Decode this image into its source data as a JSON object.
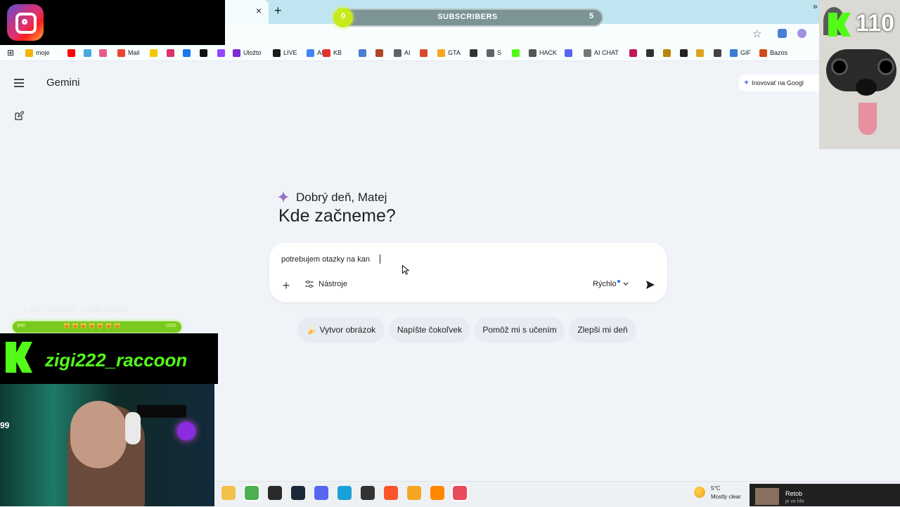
{
  "browser": {
    "new_tab_symbol": "+",
    "close_symbol": "×",
    "bookmarks": [
      {
        "label": "moje",
        "color": "#f4b400"
      },
      {
        "label": "",
        "color": "#ff0000"
      },
      {
        "label": "",
        "color": "#4aa8e0"
      },
      {
        "label": "",
        "color": "#e85a8a"
      },
      {
        "label": "Mail",
        "color": "#ea4335"
      },
      {
        "label": "",
        "color": "#f6c700"
      },
      {
        "label": "",
        "color": "#e1306c"
      },
      {
        "label": "",
        "color": "#1877f2"
      },
      {
        "label": "",
        "color": "#111111"
      },
      {
        "label": "",
        "color": "#9146ff"
      },
      {
        "label": "Uložto",
        "color": "#7a2bd3"
      },
      {
        "label": "LIVE",
        "color": "#1a1a1a"
      },
      {
        "label": "AI",
        "color": "#4285f4"
      },
      {
        "label": "KB",
        "color": "#e6322c"
      },
      {
        "label": "",
        "color": "#4a7fd6"
      },
      {
        "label": "",
        "color": "#b0442a"
      },
      {
        "label": "AI",
        "color": "#5f6368"
      },
      {
        "label": "",
        "color": "#d94a2a"
      },
      {
        "label": "GTA",
        "color": "#f5a623"
      },
      {
        "label": "",
        "color": "#333333"
      },
      {
        "label": "S",
        "color": "#5f6368"
      },
      {
        "label": "",
        "color": "#53fc18"
      },
      {
        "label": "HACK",
        "color": "#555555"
      },
      {
        "label": "",
        "color": "#5865f2"
      },
      {
        "label": "AI CHAT",
        "color": "#777777"
      },
      {
        "label": "",
        "color": "#c2185b"
      },
      {
        "label": "",
        "color": "#333333"
      },
      {
        "label": "",
        "color": "#b8860b"
      },
      {
        "label": "",
        "color": "#222222"
      },
      {
        "label": "",
        "color": "#e0a020"
      },
      {
        "label": "",
        "color": "#444444"
      },
      {
        "label": "GIF",
        "color": "#3a7bd5"
      },
      {
        "label": "Bazos",
        "color": "#d24a1a"
      }
    ],
    "more_symbol": "»"
  },
  "subscribers": {
    "label": "SUBSCRIBERS",
    "min": "0",
    "max": "5",
    "progress": 0
  },
  "app": {
    "title": "Gemini",
    "upgrade_label": "Inovovať na Googl",
    "greeting": "Dobrý deň, Matej",
    "headline": "Kde začneme?",
    "prompt_value": "potrebujem otazky na kan",
    "plus_symbol": "+",
    "tools_label": "Nástroje",
    "model_label": "Rýchlo",
    "chips": [
      {
        "label": "Vytvor obrázok",
        "icon": "🍌"
      },
      {
        "label": "Napíšte čokoľvek",
        "icon": ""
      },
      {
        "label": "Pomôž mi s učením",
        "icon": ""
      },
      {
        "label": "Zlepši mi deň",
        "icon": ""
      }
    ]
  },
  "overlay": {
    "last_follower": "Last follower: maduskaqn",
    "goal_min": "990",
    "goal_max": "1000",
    "goal_cats": "🐱🐱🐱🐱🐱🐱🐱",
    "streamer_name": "zigi222_raccoon",
    "kick_count": "110",
    "cam_number": "99"
  },
  "taskbar": {
    "weather_temp": "5°C",
    "weather_desc": "Mostly clear",
    "notif_title": "Retob",
    "notif_sub": "je ve hře",
    "apps": [
      {
        "name": "file-explorer-icon",
        "color": "#f2c14a"
      },
      {
        "name": "chrome-icon",
        "color": "#4caf50"
      },
      {
        "name": "epic-games-icon",
        "color": "#2a2a2a"
      },
      {
        "name": "steam-icon",
        "color": "#1b2838"
      },
      {
        "name": "discord-icon",
        "color": "#5865f2"
      },
      {
        "name": "edge-icon",
        "color": "#1aa0d8"
      },
      {
        "name": "davinci-icon",
        "color": "#333333"
      },
      {
        "name": "brave-icon",
        "color": "#fb542b"
      },
      {
        "name": "app-orange-icon",
        "color": "#f5a623"
      },
      {
        "name": "vlc-icon",
        "color": "#ff8800"
      },
      {
        "name": "obs-window-icon",
        "color": "#e94b5a"
      }
    ]
  }
}
